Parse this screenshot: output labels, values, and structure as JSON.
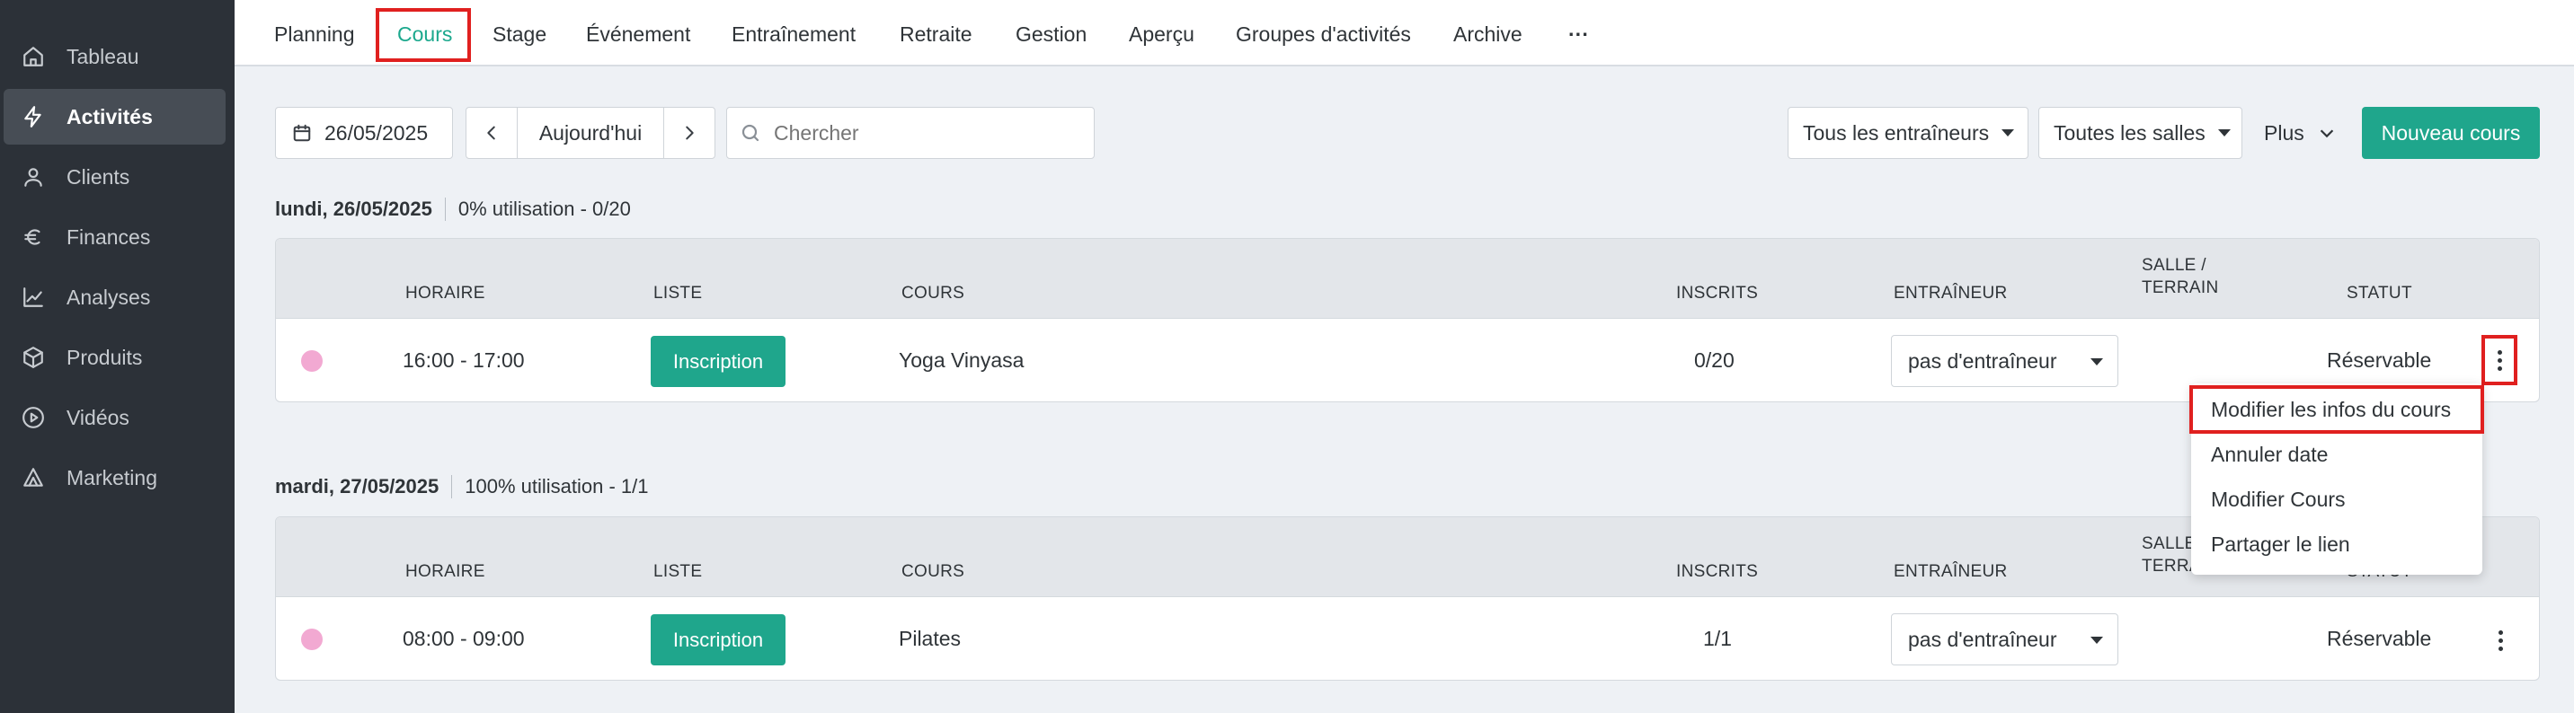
{
  "sidebar": {
    "items": [
      {
        "label": "Tableau",
        "icon": "home-icon"
      },
      {
        "label": "Activités",
        "icon": "bolt-icon",
        "active": true
      },
      {
        "label": "Clients",
        "icon": "user-icon"
      },
      {
        "label": "Finances",
        "icon": "euro-icon"
      },
      {
        "label": "Analyses",
        "icon": "chart-line-icon"
      },
      {
        "label": "Produits",
        "icon": "box-icon"
      },
      {
        "label": "Vidéos",
        "icon": "play-circle-icon"
      },
      {
        "label": "Marketing",
        "icon": "megaphone-icon"
      }
    ]
  },
  "tabs": [
    "Planning",
    "Cours",
    "Stage",
    "Événement",
    "Entraînement",
    "Retraite",
    "Gestion",
    "Aperçu",
    "Groupes d'activités",
    "Archive",
    "···"
  ],
  "active_tab": "Cours",
  "toolbar": {
    "date": "26/05/2025",
    "today": "Aujourd'hui",
    "search_placeholder": "Chercher",
    "trainers": "Tous les entraîneurs",
    "rooms": "Toutes les salles",
    "more": "Plus",
    "new_course": "Nouveau cours"
  },
  "columns": {
    "horaire": "HORAIRE",
    "liste": "LISTE",
    "cours": "COURS",
    "inscrits": "INSCRITS",
    "entraineur": "ENTRAÎNEUR",
    "salle_1": "SALLE /",
    "salle_2": "TERRAIN",
    "statut": "STATUT"
  },
  "days": [
    {
      "date": "lundi, 26/05/2025",
      "utilisation": "0% utilisation - 0/20",
      "row": {
        "time": "16:00 - 17:00",
        "list_button": "Inscription",
        "course": "Yoga Vinyasa",
        "registered": "0/20",
        "trainer": "pas d'entraîneur",
        "status": "Réservable"
      }
    },
    {
      "date": "mardi, 27/05/2025",
      "utilisation": "100% utilisation - 1/1",
      "row": {
        "time": "08:00 - 09:00",
        "list_button": "Inscription",
        "course": "Pilates",
        "registered": "1/1",
        "trainer": "pas d'entraîneur",
        "status": "Réservable"
      }
    }
  ],
  "context_menu": [
    "Modifier les infos du cours",
    "Annuler date",
    "Modifier Cours",
    "Partager le lien"
  ],
  "colors": {
    "accent": "#1fa68c",
    "highlight": "#e0201f",
    "sidebar": "#2c3138"
  }
}
